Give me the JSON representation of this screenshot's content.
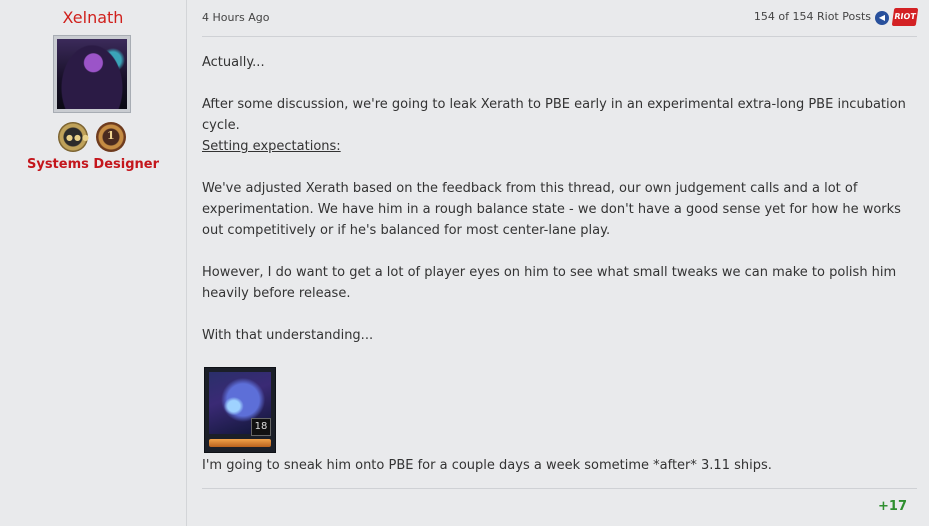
{
  "user": {
    "name": "Xelnath",
    "role": "Systems Designer",
    "badges": {
      "team_icon": "team-badge-icon",
      "rank_number": "1"
    }
  },
  "post": {
    "timestamp": "4 Hours Ago",
    "riot_posts_count": "154 of 154 Riot Posts",
    "paragraphs": {
      "p1": "Actually...",
      "p2": "After some discussion, we're going to leak Xerath to PBE early in an experimental extra-long PBE incubation cycle.",
      "p3": "Setting expectations:",
      "p4": "We've adjusted Xerath based on the feedback from this thread, our own judgement calls and a lot of experimentation. We have him in a rough balance state - we don't have a good sense yet for how he works out competitively or if he's balanced for most center-lane play.",
      "p5": "However, I do want to get a lot of player eyes on him to see what small tweaks we can make to polish him heavily before release.",
      "p6": "With that understanding...",
      "p7": "I'm going to sneak him onto PBE for a couple days a week sometime *after* 3.11 ships."
    },
    "champion": {
      "level": "18"
    },
    "score": "+17"
  },
  "colors": {
    "username": "#d0201c",
    "role": "#c4161c",
    "score": "#2f8f2f",
    "background": "#e9eaec"
  },
  "icons": {
    "prev_post": "previous-post-icon",
    "riot_logo": "riot-logo-icon"
  }
}
